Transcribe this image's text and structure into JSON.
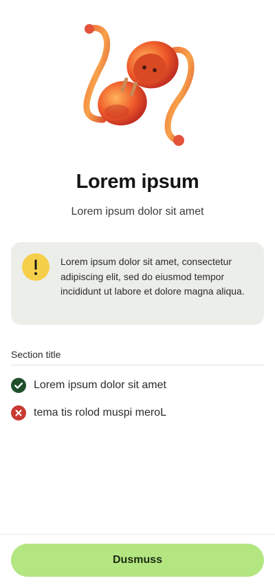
{
  "hero": {
    "icon": "unplugged-power-plug-illustration"
  },
  "header": {
    "title": "Lorem ipsum",
    "subtitle": "Lorem ipsum dolor sit amet"
  },
  "alert": {
    "icon": "exclamation-icon",
    "icon_color": "#f6cf4a",
    "background": "#eceee9",
    "text": "Lorem ipsum dolor sit amet, consectetur adipiscing elit, sed do eiusmod tempor incididunt ut labore et dolore magna aliqua."
  },
  "section": {
    "title": "Section title",
    "items": [
      {
        "icon": "check-circle-icon",
        "status": "success",
        "color": "#1f4f2b",
        "label": "Lorem ipsum dolor sit amet"
      },
      {
        "icon": "close-circle-icon",
        "status": "error",
        "color": "#c83a32",
        "label": "tema tis rolod muspi meroL"
      }
    ]
  },
  "footer": {
    "button_label": "Dusmuss",
    "button_color": "#b3e681"
  }
}
